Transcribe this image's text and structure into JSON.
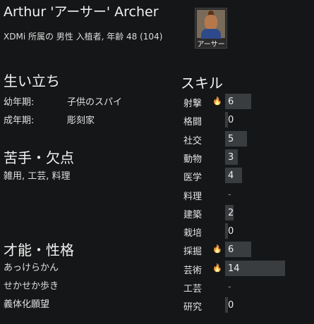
{
  "pawn": {
    "name": "Arthur 'アーサー' Archer",
    "description": "XDMi 所属の 男性 入植者, 年齢 48 (104)",
    "portrait_label": "アーサー"
  },
  "backstory": {
    "title": "生い立ち",
    "childhood_label": "幼年期:",
    "childhood_value": "子供のスパイ",
    "adulthood_label": "成年期:",
    "adulthood_value": "彫刻家"
  },
  "incapable": {
    "title": "苦手・欠点",
    "text": "雑用, 工芸, 料理"
  },
  "traits": {
    "title": "才能・性格",
    "items": [
      "あっけらかん",
      "せかせか歩き",
      "義体化願望"
    ]
  },
  "skills": {
    "title": "スキル",
    "max_level": 20,
    "items": [
      {
        "name": "射撃",
        "level": "6",
        "level_num": 6,
        "passion": true
      },
      {
        "name": "格闘",
        "level": "0",
        "level_num": 0,
        "passion": false
      },
      {
        "name": "社交",
        "level": "5",
        "level_num": 5,
        "passion": false
      },
      {
        "name": "動物",
        "level": "3",
        "level_num": 3,
        "passion": false
      },
      {
        "name": "医学",
        "level": "4",
        "level_num": 4,
        "passion": false
      },
      {
        "name": "料理",
        "level": "-",
        "level_num": 0,
        "passion": false,
        "disabled": true
      },
      {
        "name": "建築",
        "level": "2",
        "level_num": 2,
        "passion": false
      },
      {
        "name": "栽培",
        "level": "0",
        "level_num": 0,
        "passion": false
      },
      {
        "name": "採掘",
        "level": "6",
        "level_num": 6,
        "passion": true
      },
      {
        "name": "芸術",
        "level": "14",
        "level_num": 14,
        "passion": true
      },
      {
        "name": "工芸",
        "level": "-",
        "level_num": 0,
        "passion": false,
        "disabled": true
      },
      {
        "name": "研究",
        "level": "0",
        "level_num": 0,
        "passion": false
      }
    ]
  },
  "colors": {
    "background": "#151617",
    "bar_fill": "#3a3d40",
    "passion_flame": "#e6a23c"
  }
}
